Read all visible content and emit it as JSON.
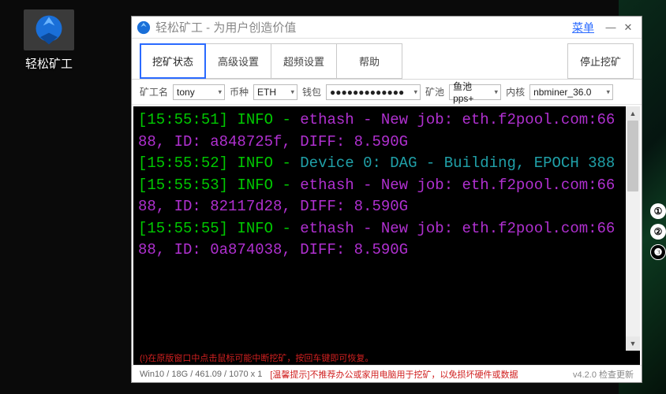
{
  "desktop": {
    "icon_label": "轻松矿工"
  },
  "window": {
    "title": "轻松矿工 - 为用户创造价值",
    "menu_label": "菜单"
  },
  "tabs": {
    "mining_status": "挖矿状态",
    "advanced": "高级设置",
    "overclock": "超频设置",
    "help": "帮助"
  },
  "actions": {
    "stop_mining": "停止挖矿"
  },
  "config": {
    "miner_label": "矿工名",
    "miner_value": "tony",
    "coin_label": "币种",
    "coin_value": "ETH",
    "wallet_label": "钱包",
    "wallet_value": "●●●●●●●●●●●●●",
    "pool_label": "矿池",
    "pool_value": "鱼池pps+",
    "kernel_label": "内核",
    "kernel_value": "nbminer_36.0"
  },
  "console": {
    "lines": [
      {
        "ts": "[15:55:51]",
        "lvl": "INFO",
        "kind": "eth",
        "txt": "ethash - New job: eth.f2pool.com:6688, ID: a848725f, DIFF: 8.590G"
      },
      {
        "ts": "[15:55:52]",
        "lvl": "INFO",
        "kind": "dev",
        "txt": "Device 0: DAG - Building, EPOCH 388"
      },
      {
        "ts": "[15:55:53]",
        "lvl": "INFO",
        "kind": "eth",
        "txt": "ethash - New job: eth.f2pool.com:6688, ID: 82117d28, DIFF: 8.590G"
      },
      {
        "ts": "[15:55:55]",
        "lvl": "INFO",
        "kind": "eth",
        "txt": "ethash - New job: eth.f2pool.com:6688, ID: 0a874038, DIFF: 8.590G"
      }
    ],
    "hint": "(!)在原版窗口中点击鼠标可能中断挖矿，按回车键即可恢复。"
  },
  "status": {
    "sys": "Win10  /  18G / 461.09  / 1070 x 1",
    "warn": "[温馨提示]不推荐办公或家用电脑用于挖矿，以免损坏硬件或数据",
    "version": "v4.2.0 检查更新"
  },
  "badges": [
    "①",
    "②",
    "❸"
  ]
}
